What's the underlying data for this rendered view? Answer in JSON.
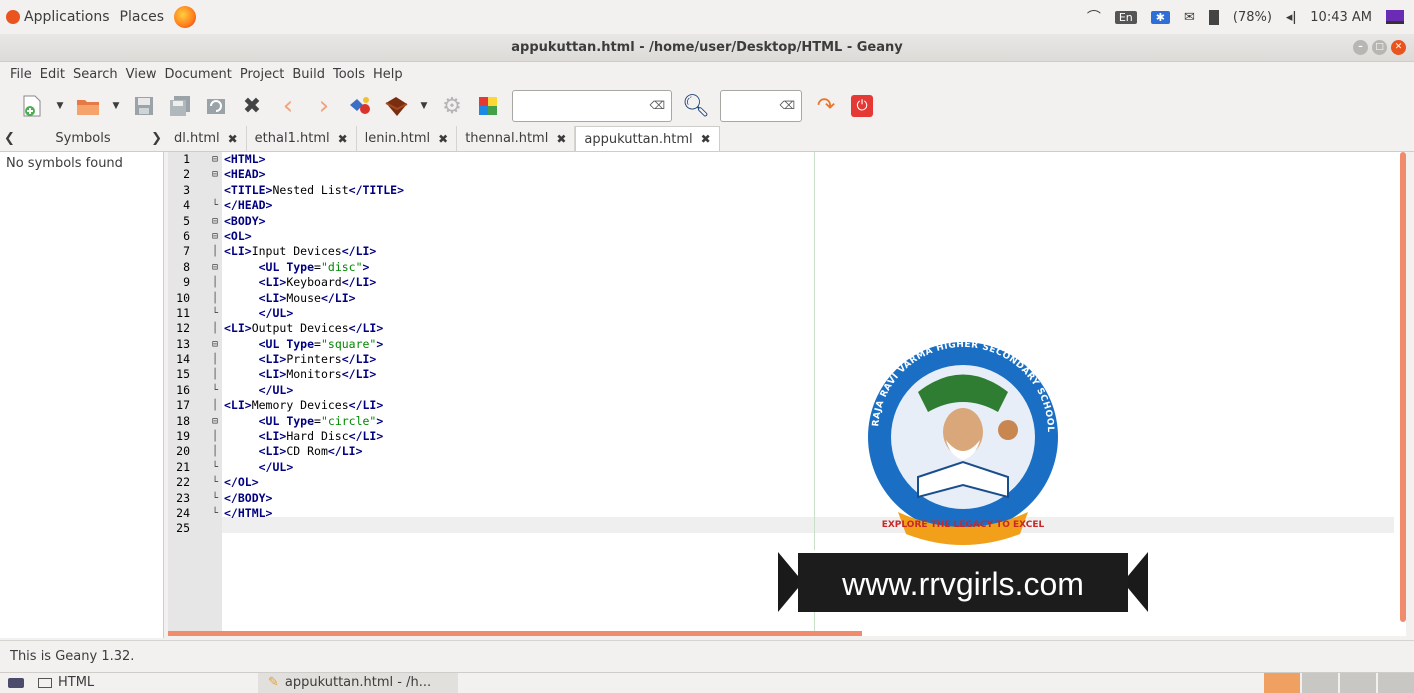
{
  "topbar": {
    "applications": "Applications",
    "places": "Places",
    "lang": "En",
    "battery": "(78%)",
    "time": "10:43 AM"
  },
  "window": {
    "title": "appukuttan.html - /home/user/Desktop/HTML - Geany"
  },
  "menu": [
    "File",
    "Edit",
    "Search",
    "View",
    "Document",
    "Project",
    "Build",
    "Tools",
    "Help"
  ],
  "sidebar": {
    "tab_label": "Symbols",
    "empty_text": "No symbols found"
  },
  "tabs": [
    "dl.html",
    "ethal1.html",
    "lenin.html",
    "thennal.html",
    "appukuttan.html"
  ],
  "active_tab": 4,
  "code_lines": [
    [
      [
        "t",
        "<HTML>"
      ]
    ],
    [
      [
        "t",
        "<HEAD>"
      ]
    ],
    [
      [
        "t",
        "<TITLE>"
      ],
      [
        "p",
        "Nested List"
      ],
      [
        "t",
        "</TITLE>"
      ]
    ],
    [
      [
        "t",
        "</HEAD>"
      ]
    ],
    [
      [
        "t",
        "<BODY>"
      ]
    ],
    [
      [
        "t",
        "<OL>"
      ]
    ],
    [
      [
        "t",
        "<LI>"
      ],
      [
        "p",
        "Input Devices"
      ],
      [
        "t",
        "</LI>"
      ]
    ],
    [
      [
        "p",
        "     "
      ],
      [
        "t",
        "<UL "
      ],
      [
        "a",
        "Type"
      ],
      [
        "p",
        "="
      ],
      [
        "s",
        "\"disc\""
      ],
      [
        "t",
        ">"
      ]
    ],
    [
      [
        "p",
        "     "
      ],
      [
        "t",
        "<LI>"
      ],
      [
        "p",
        "Keyboard"
      ],
      [
        "t",
        "</LI>"
      ]
    ],
    [
      [
        "p",
        "     "
      ],
      [
        "t",
        "<LI>"
      ],
      [
        "p",
        "Mouse"
      ],
      [
        "t",
        "</LI>"
      ]
    ],
    [
      [
        "p",
        "     "
      ],
      [
        "t",
        "</UL>"
      ]
    ],
    [
      [
        "t",
        "<LI>"
      ],
      [
        "p",
        "Output Devices"
      ],
      [
        "t",
        "</LI>"
      ]
    ],
    [
      [
        "p",
        "     "
      ],
      [
        "t",
        "<UL "
      ],
      [
        "a",
        "Type"
      ],
      [
        "p",
        "="
      ],
      [
        "s",
        "\"square\""
      ],
      [
        "t",
        ">"
      ]
    ],
    [
      [
        "p",
        "     "
      ],
      [
        "t",
        "<LI>"
      ],
      [
        "p",
        "Printers"
      ],
      [
        "t",
        "</LI>"
      ]
    ],
    [
      [
        "p",
        "     "
      ],
      [
        "t",
        "<LI>"
      ],
      [
        "p",
        "Monitors"
      ],
      [
        "t",
        "</LI>"
      ]
    ],
    [
      [
        "p",
        "     "
      ],
      [
        "t",
        "</UL>"
      ]
    ],
    [
      [
        "t",
        "<LI>"
      ],
      [
        "p",
        "Memory Devices"
      ],
      [
        "t",
        "</LI>"
      ]
    ],
    [
      [
        "p",
        "     "
      ],
      [
        "t",
        "<UL "
      ],
      [
        "a",
        "Type"
      ],
      [
        "p",
        "="
      ],
      [
        "s",
        "\"circle\""
      ],
      [
        "t",
        ">"
      ]
    ],
    [
      [
        "p",
        "     "
      ],
      [
        "t",
        "<LI>"
      ],
      [
        "p",
        "Hard Disc"
      ],
      [
        "t",
        "</LI>"
      ]
    ],
    [
      [
        "p",
        "     "
      ],
      [
        "t",
        "<LI>"
      ],
      [
        "p",
        "CD Rom"
      ],
      [
        "t",
        "</LI>"
      ]
    ],
    [
      [
        "p",
        "     "
      ],
      [
        "t",
        "</UL>"
      ]
    ],
    [
      [
        "t",
        "</OL>"
      ]
    ],
    [
      [
        "t",
        "</BODY>"
      ]
    ],
    [
      [
        "t",
        "</HTML>"
      ]
    ],
    []
  ],
  "fold_markers": [
    "⊟",
    "⊟",
    "",
    "└",
    "⊟",
    "⊟",
    "│",
    "⊟",
    "│",
    "│",
    "└",
    "│",
    "⊟",
    "│",
    "│",
    "└",
    "│",
    "⊟",
    "│",
    "│",
    "└",
    "└",
    "└",
    "└",
    ""
  ],
  "logo": {
    "arc_text": "RAJA RAVI VARMA HIGHER SECONDARY SCHOOLS KILIMANOOR (GOVT. AIDED)",
    "ribbon_text": "EXPLORE THE LEGACY TO EXCEL",
    "banner_text": "www.rrvgirls.com"
  },
  "status": {
    "message": "This is Geany 1.32."
  },
  "taskbar": {
    "item1": "HTML",
    "item2": "appukuttan.html - /h..."
  },
  "colors": {
    "accent": "#f08c6c",
    "tag": "#000080",
    "string": "#008800",
    "close": "#e9541f"
  }
}
